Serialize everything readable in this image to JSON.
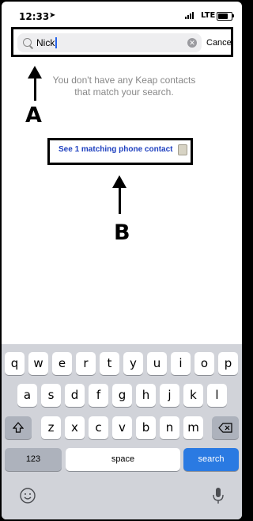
{
  "status_bar": {
    "time": "12:33",
    "location_glyph": "➤",
    "network": "LTE"
  },
  "search": {
    "query": "Nick",
    "clear_icon": "clear-icon",
    "cancel_label": "Cancel"
  },
  "annotations": {
    "a_label": "A",
    "b_label": "B"
  },
  "results": {
    "empty_message_line1": "You don't have any Keap contacts",
    "empty_message_line2": "that match your search.",
    "phone_match_link": "See 1 matching phone contact"
  },
  "keyboard": {
    "row1": [
      "q",
      "w",
      "e",
      "r",
      "t",
      "y",
      "u",
      "i",
      "o",
      "p"
    ],
    "row2": [
      "a",
      "s",
      "d",
      "f",
      "g",
      "h",
      "j",
      "k",
      "l"
    ],
    "row3": [
      "z",
      "x",
      "c",
      "v",
      "b",
      "n",
      "m"
    ],
    "numbers_label": "123",
    "space_label": "space",
    "search_label": "search"
  },
  "colors": {
    "accent": "#2a7ae2",
    "link": "#1d3fbf",
    "keyboard_bg": "#d1d3d9"
  }
}
